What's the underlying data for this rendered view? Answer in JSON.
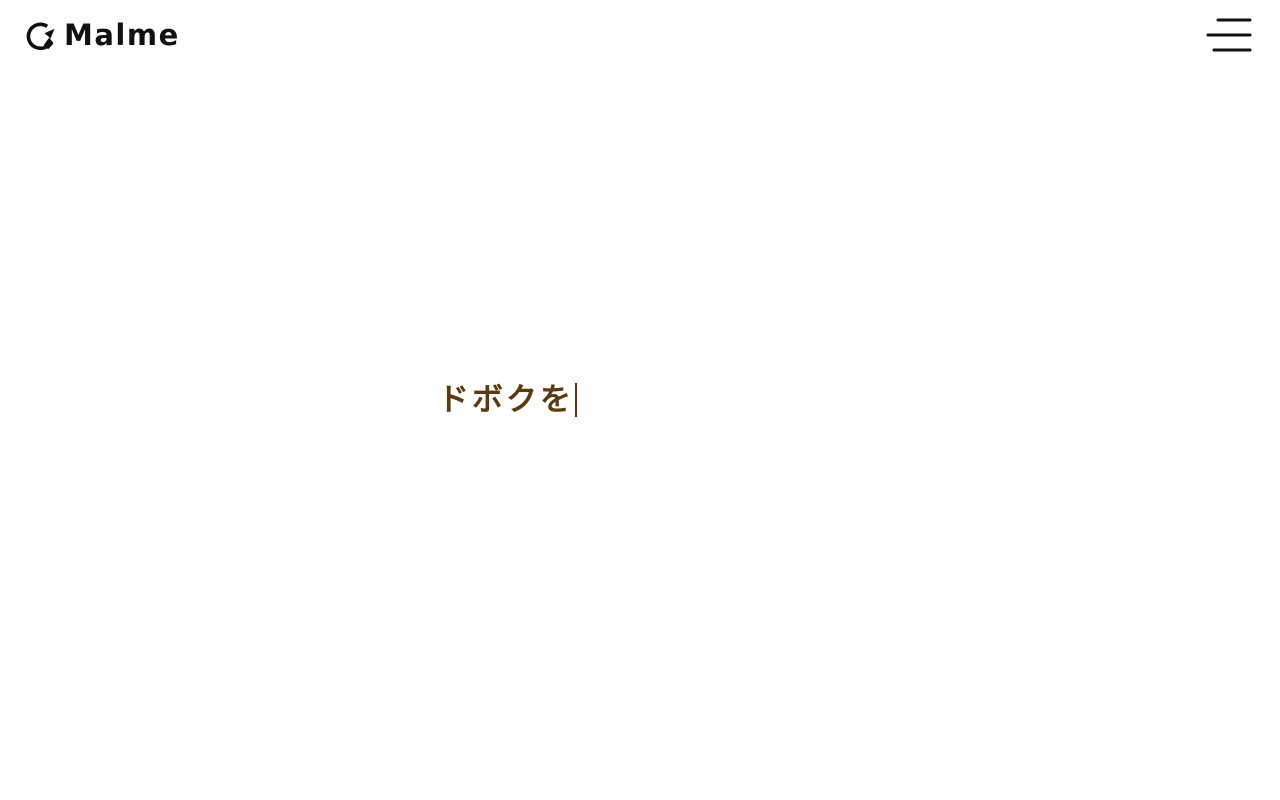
{
  "brand": {
    "name": "Malme",
    "logo_icon": "refresh-arrow-icon"
  },
  "header": {
    "menu_icon": "hamburger-menu-icon"
  },
  "hero": {
    "typing_text": "ドボクを"
  },
  "colors": {
    "text_dark": "#111111",
    "accent_brown": "#5a3a0e",
    "background": "#ffffff"
  }
}
